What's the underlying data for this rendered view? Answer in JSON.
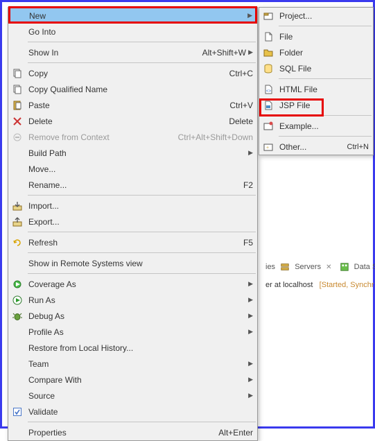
{
  "context_menu": {
    "new": "New",
    "go_into": "Go Into",
    "show_in": "Show In",
    "show_in_accel": "Alt+Shift+W",
    "copy": "Copy",
    "copy_accel": "Ctrl+C",
    "copy_qualified": "Copy Qualified Name",
    "paste": "Paste",
    "paste_accel": "Ctrl+V",
    "delete": "Delete",
    "delete_accel": "Delete",
    "remove_context": "Remove from Context",
    "remove_context_accel": "Ctrl+Alt+Shift+Down",
    "build_path": "Build Path",
    "move": "Move...",
    "rename": "Rename...",
    "rename_accel": "F2",
    "import": "Import...",
    "export": "Export...",
    "refresh": "Refresh",
    "refresh_accel": "F5",
    "show_remote": "Show in Remote Systems view",
    "coverage_as": "Coverage As",
    "run_as": "Run As",
    "debug_as": "Debug As",
    "profile_as": "Profile As",
    "restore_history": "Restore from Local History...",
    "team": "Team",
    "compare_with": "Compare With",
    "source": "Source",
    "validate": "Validate",
    "properties": "Properties",
    "properties_accel": "Alt+Enter"
  },
  "submenu": {
    "project": "Project...",
    "file": "File",
    "folder": "Folder",
    "sql_file": "SQL File",
    "html_file": "HTML File",
    "jsp_file": "JSP File",
    "example": "Example...",
    "other": "Other...",
    "other_accel": "Ctrl+N"
  },
  "background": {
    "tabs_properties": "ies",
    "tabs_servers": "Servers",
    "tabs_data": "Data S",
    "server_text": "er at localhost",
    "server_status": "[Started, Synchr"
  }
}
